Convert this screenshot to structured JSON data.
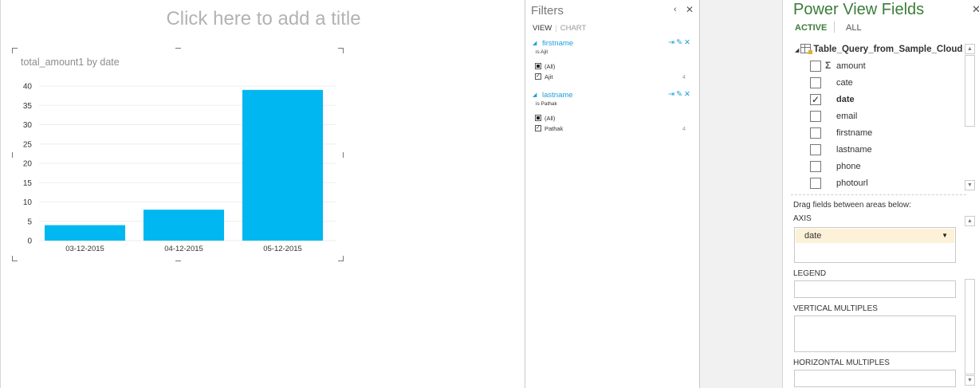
{
  "canvas": {
    "title_placeholder": "Click here to add a title"
  },
  "chart_data": {
    "type": "bar",
    "title": "total_amount1 by date",
    "categories": [
      "03-12-2015",
      "04-12-2015",
      "05-12-2015"
    ],
    "values": [
      4,
      8,
      39
    ],
    "ylim": [
      0,
      40
    ],
    "yticks": [
      0,
      5,
      10,
      15,
      20,
      25,
      30,
      35,
      40
    ],
    "grid": true,
    "bar_color": "#00b7f1"
  },
  "filters": {
    "title": "Filters",
    "tabs": {
      "view": "VIEW",
      "chart": "CHART"
    },
    "groups": [
      {
        "field": "firstname",
        "condition": "is Ajit",
        "items": [
          {
            "label": "(All)"
          },
          {
            "label": "Ajit",
            "count": "4"
          }
        ]
      },
      {
        "field": "lastname",
        "condition": "is Pathak",
        "items": [
          {
            "label": "(All)"
          },
          {
            "label": "Pathak",
            "count": "4"
          }
        ]
      }
    ]
  },
  "fields": {
    "title": "Power View Fields",
    "tabs": {
      "active": "ACTIVE",
      "all": "ALL"
    },
    "table_name": "Table_Query_from_Sample_Cloud",
    "items": [
      {
        "name": "amount",
        "sigma": "Σ",
        "checked": false
      },
      {
        "name": "cate",
        "checked": false
      },
      {
        "name": "date",
        "checked": true
      },
      {
        "name": "email",
        "checked": false
      },
      {
        "name": "firstname",
        "checked": false
      },
      {
        "name": "lastname",
        "checked": false
      },
      {
        "name": "phone",
        "checked": false
      },
      {
        "name": "photourl",
        "checked": false
      }
    ],
    "drag_hint": "Drag fields between areas below:",
    "areas": {
      "axis": {
        "label": "AXIS",
        "value": "date"
      },
      "legend": {
        "label": "LEGEND"
      },
      "vertical": {
        "label": "VERTICAL MULTIPLES"
      },
      "horizontal": {
        "label": "HORIZONTAL MULTIPLES"
      }
    }
  }
}
